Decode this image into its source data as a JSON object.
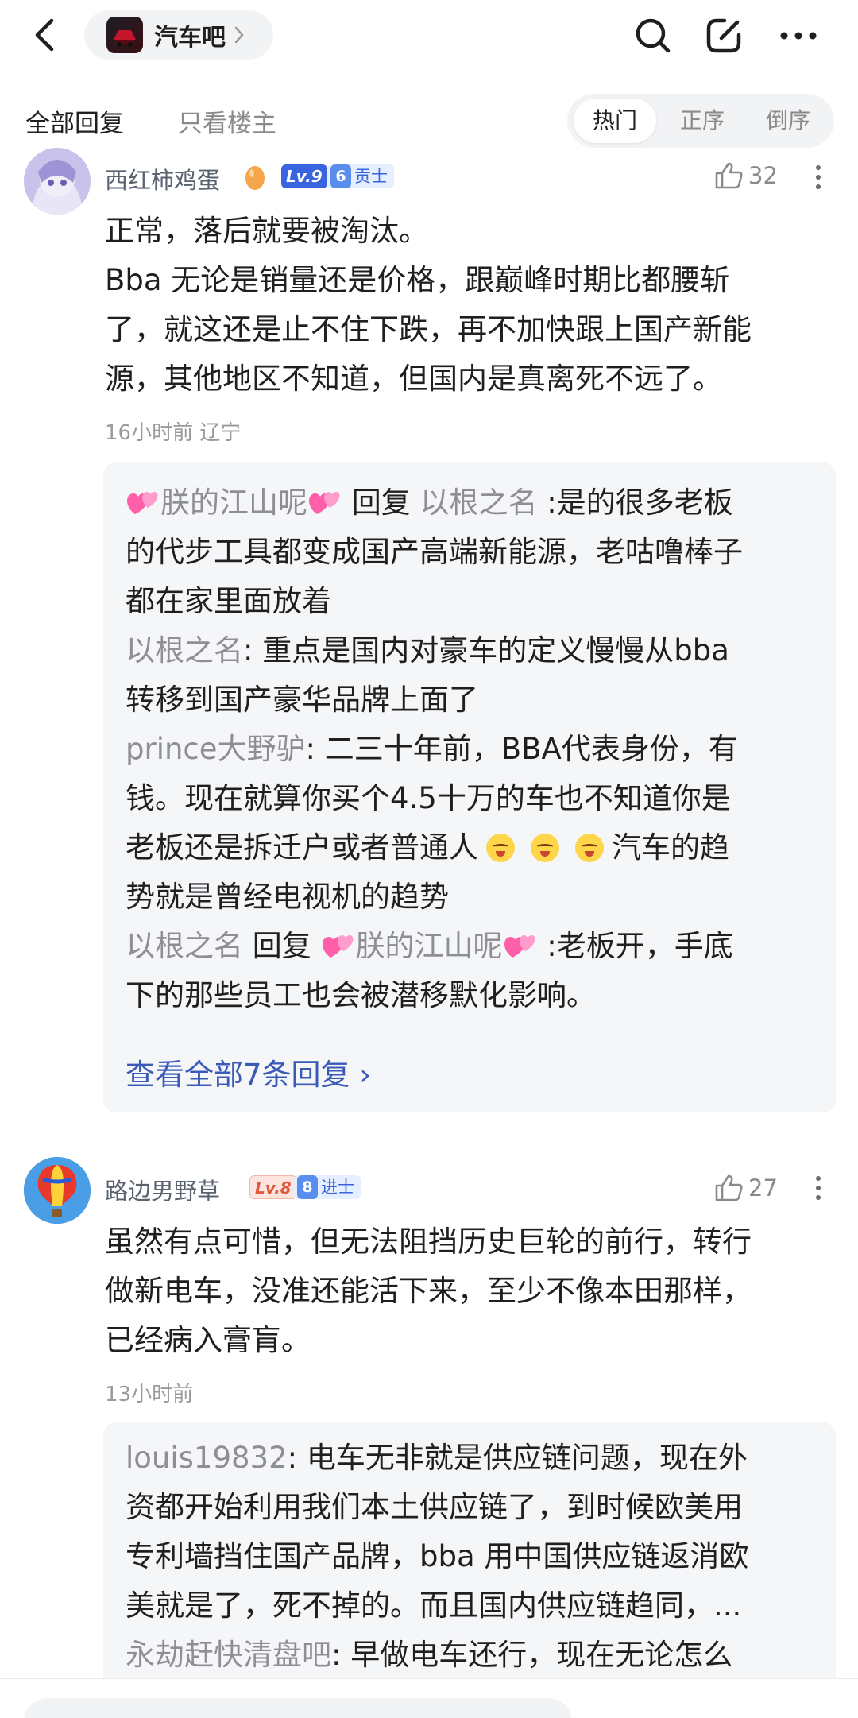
{
  "header": {
    "forum_name": "汽车吧",
    "icons": {
      "back": "back-arrow-icon",
      "search": "search-icon",
      "edit": "edit-icon",
      "more": "more-icon"
    }
  },
  "tabs": {
    "all": "全部回复",
    "op_only": "只看楼主",
    "sort": [
      "热门",
      "正序",
      "倒序"
    ],
    "sort_active": "热门"
  },
  "comment1": {
    "username": "西红柿鸡蛋",
    "level": "Lv.9",
    "rank_num": "6",
    "rank_title": "贡士",
    "likes": "32",
    "lines": [
      "正常，落后就要被淘汰。",
      "Bba 无论是销量还是价格，跟巅峰时期比都腰斩",
      "了，就这还是止不住下跌，再不加快跟上国产新能",
      "源，其他地区不知道，但国内是真离死不远了。"
    ],
    "meta": "16小时前  辽宁",
    "replies": {
      "r1_name": "朕的江山呢",
      "r1_verb": "回复",
      "r1_target": "以根之名",
      "r1_line1": ":是的很多老板",
      "r1_line2": "的代步工具都变成国产高端新能源，老咕噜棒子",
      "r1_line3": "都在家里面放着",
      "r2_name": "以根之名",
      "r2_line1": ": 重点是国内对豪车的定义慢慢从bba",
      "r2_line2": "转移到国产豪华品牌上面了",
      "r3_name": "prince大野驴",
      "r3_line1": ": 二三十年前，BBA代表身份，有",
      "r3_line2": "钱。现在就算你买个4.5十万的车也不知道你是",
      "r3_line3a": "老板还是拆迁户或者普通人",
      "r3_line3b": "汽车的趋",
      "r3_line4": "势就是曾经电视机的趋势",
      "r4_name": "以根之名",
      "r4_verb": "回复",
      "r4_target": "朕的江山呢",
      "r4_line1": ":老板开，手底",
      "r4_line2": "下的那些员工也会被潜移默化影响。",
      "view_all": "查看全部7条回复 ›"
    }
  },
  "comment2": {
    "username": "路边男野草",
    "level": "Lv.8",
    "rank_num": "8",
    "rank_title": "进士",
    "likes": "27",
    "lines": [
      "虽然有点可惜，但无法阻挡历史巨轮的前行，转行",
      "做新电车，没准还能活下来，至少不像本田那样，",
      "已经病入膏肓。"
    ],
    "meta": "13小时前",
    "replies": {
      "r1_name": "louis19832",
      "r1_line1": ": 电车无非就是供应链问题，现在外",
      "r1_line2": "资都开始利用我们本土供应链了，到时候欧美用",
      "r1_line3": "专利墙挡住国产品牌，bba 用中国供应链返消欧",
      "r1_line4": "美就是了，死不掉的。而且国内供应链趋同，...",
      "r2_name": "永劫赶快清盘吧",
      "r2_line1": ": 早做电车还行，现在无论怎么"
    }
  },
  "colors": {
    "accent_link": "#3a5ab8",
    "username": "#5a6270",
    "reply_name": "#8e8e95",
    "lv9": "#3a63e0",
    "lv8": "#e0593a"
  }
}
